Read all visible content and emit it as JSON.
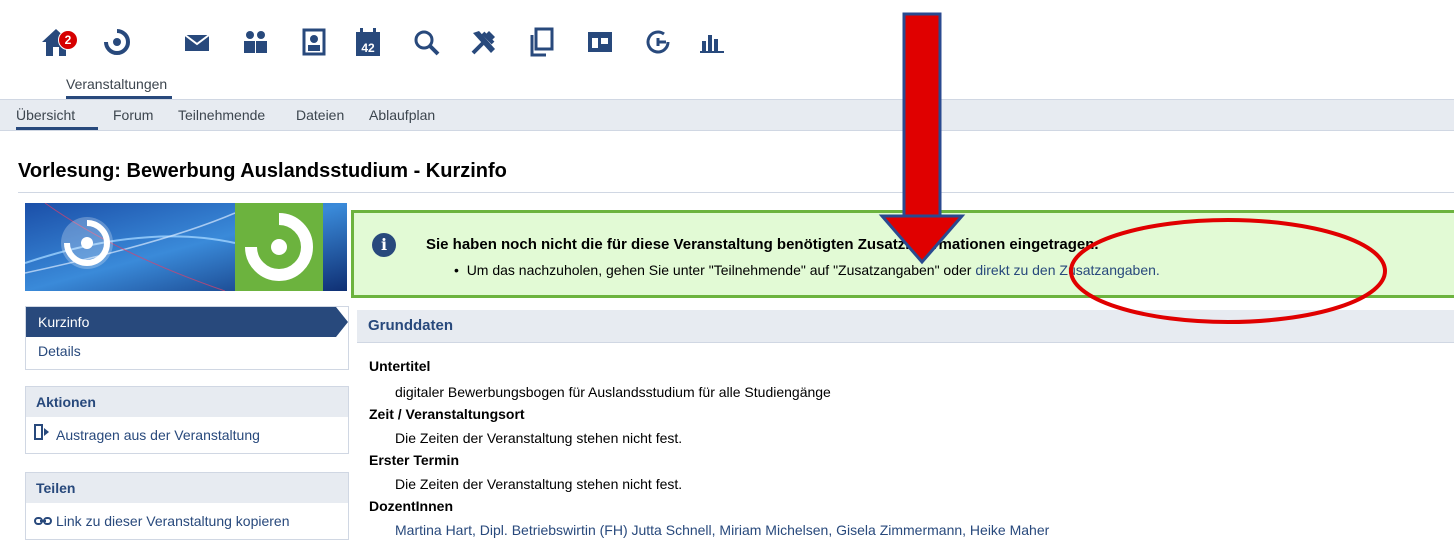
{
  "nav": {
    "notification_count": "2",
    "active_label": "Veranstaltungen",
    "calendar_day": "42"
  },
  "subnav": {
    "items": [
      "Übersicht",
      "Forum",
      "Teilnehmende",
      "Dateien",
      "Ablaufplan"
    ]
  },
  "page": {
    "title": "Vorlesung: Bewerbung Auslandsstudium - Kurzinfo"
  },
  "sidebar": {
    "nav_items": [
      "Kurzinfo",
      "Details"
    ],
    "actions_title": "Aktionen",
    "actions_item": "Austragen aus der Veranstaltung",
    "share_title": "Teilen",
    "share_item": "Link zu dieser Veranstaltung kopieren"
  },
  "message": {
    "title": "Sie haben noch nicht die für diese Veranstaltung benötigten Zusatzinformationen eingetragen.",
    "bullet": "•",
    "text": "Um das nachzuholen, gehen Sie unter \"Teilnehmende\" auf \"Zusatzangaben\" oder ",
    "link": "direkt zu den Zusatzangaben."
  },
  "grunddaten": {
    "title": "Grunddaten",
    "untertitel_label": "Untertitel",
    "untertitel_value": "digitaler Bewerbungsbogen für Auslandsstudium für alle Studiengänge",
    "zeit_label": "Zeit / Veranstaltungsort",
    "zeit_value": "Die Zeiten der Veranstaltung stehen nicht fest.",
    "termin_label": "Erster Termin",
    "termin_value": "Die Zeiten der Veranstaltung stehen nicht fest.",
    "dozent_label": "DozentInnen",
    "dozent_value": "Martina Hart, Dipl. Betriebswirtin (FH) Jutta Schnell, Miriam Michelsen, Gisela Zimmermann, Heike Maher"
  },
  "colors": {
    "brand_blue": "#28497c",
    "message_bg": "#e2fad5",
    "message_border": "#6cb33e",
    "annotation_red": "#e00000"
  }
}
